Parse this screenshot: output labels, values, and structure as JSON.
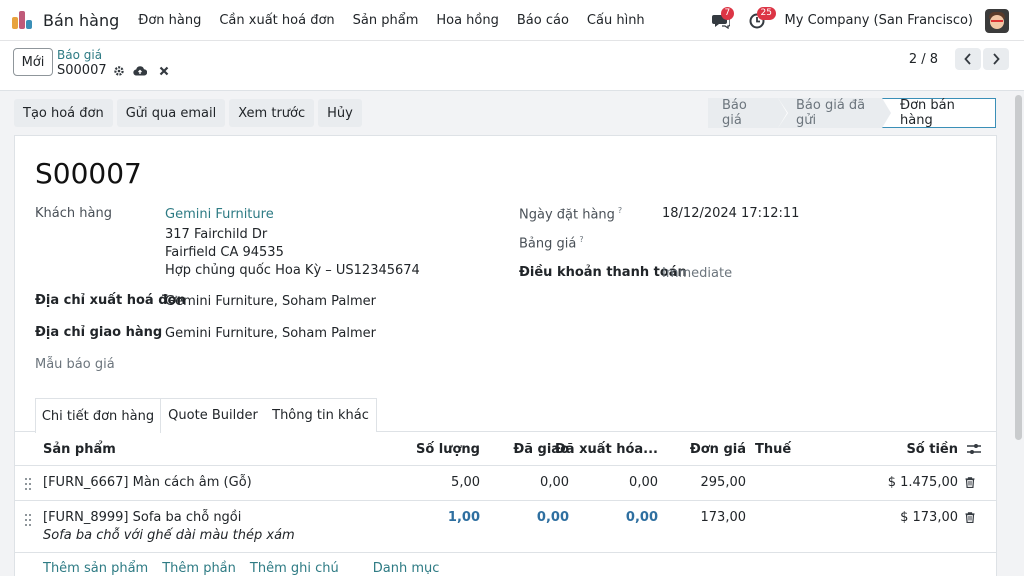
{
  "topbar": {
    "app_name": "Bán hàng",
    "menu": [
      "Đơn hàng",
      "Cần xuất hoá đơn",
      "Sản phẩm",
      "Hoa hồng",
      "Báo cáo",
      "Cấu hình"
    ],
    "messages_count": "7",
    "activities_count": "25",
    "company": "My Company (San Francisco)"
  },
  "control": {
    "new_label": "Mới",
    "breadcrumb_parent": "Báo giá",
    "breadcrumb_current": "S00007",
    "pager": "2 / 8"
  },
  "actions": [
    "Tạo hoá đơn",
    "Gửi qua email",
    "Xem trước",
    "Hủy"
  ],
  "status": {
    "stages": [
      "Báo giá",
      "Báo giá đã gửi",
      "Đơn bán hàng"
    ],
    "active": "Đơn bán hàng"
  },
  "form": {
    "name": "S00007",
    "customer_label": "Khách hàng",
    "customer_name": "Gemini Furniture",
    "customer_address_1": "317 Fairchild Dr",
    "customer_address_2": "Fairfield CA 94535",
    "customer_address_3": "Hợp chủng quốc Hoa Kỳ – US12345674",
    "invoice_address_label": "Địa chỉ xuất hoá đơn",
    "invoice_address": "Gemini Furniture, Soham Palmer",
    "delivery_address_label": "Địa chỉ giao hàng",
    "delivery_address": "Gemini Furniture, Soham Palmer",
    "quote_template_label": "Mẫu báo giá",
    "order_date_label": "Ngày đặt hàng",
    "order_date": "18/12/2024 17:12:11",
    "pricelist_label": "Bảng giá",
    "payment_terms_label": "Điều khoản thanh toán",
    "payment_terms": "Immediate",
    "help_mark": "?"
  },
  "tabs": [
    "Chi tiết đơn hàng",
    "Quote Builder",
    "Thông tin khác"
  ],
  "table": {
    "headers": {
      "product": "Sản phẩm",
      "quantity": "Số lượng",
      "delivered": "Đã giao",
      "invoiced": "Đã xuất hóa...",
      "unit_price": "Đơn giá",
      "taxes": "Thuế",
      "subtotal": "Số tiền"
    },
    "rows": [
      {
        "product": "[FURN_6667] Màn cách âm (Gỗ)",
        "description": "",
        "quantity": "5,00",
        "delivered": "0,00",
        "invoiced": "0,00",
        "unit_price": "295,00",
        "subtotal": "$ 1.475,00"
      },
      {
        "product": "[FURN_8999] Sofa ba chỗ ngồi",
        "description": "Sofa ba chỗ với ghế dài màu thép xám",
        "quantity": "1,00",
        "delivered": "0,00",
        "invoiced": "0,00",
        "unit_price": "173,00",
        "subtotal": "$ 173,00"
      }
    ],
    "add_links": [
      "Thêm sản phẩm",
      "Thêm phần",
      "Thêm ghi chú",
      "Danh mục"
    ]
  }
}
